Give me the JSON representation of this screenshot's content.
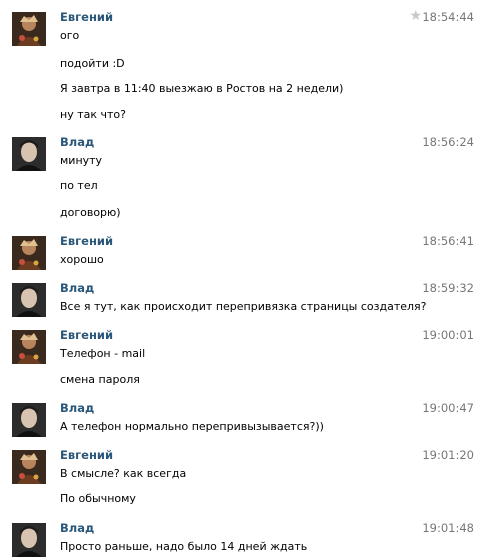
{
  "messages": [
    {
      "author": "Евгений",
      "time": "18:54:44",
      "avatar": "avatar-evgeniy",
      "starred": true,
      "lines": [
        "ого",
        "подойти :D",
        "Я завтра в 11:40 выезжаю в Ростов на 2 недели)",
        "ну так что?"
      ]
    },
    {
      "author": "Влад",
      "time": "18:56:24",
      "avatar": "avatar-vlad",
      "lines": [
        "минуту",
        "по тел",
        "договорю)"
      ]
    },
    {
      "author": "Евгений",
      "time": "18:56:41",
      "avatar": "avatar-evgeniy",
      "lines": [
        "хорошо"
      ]
    },
    {
      "author": "Влад",
      "time": "18:59:32",
      "avatar": "avatar-vlad",
      "lines": [
        "Все я тут, как происходит перепривязка страницы создателя?"
      ]
    },
    {
      "author": "Евгений",
      "time": "19:00:01",
      "avatar": "avatar-evgeniy",
      "lines": [
        "Телефон - mail",
        "смена пароля"
      ]
    },
    {
      "author": "Влад",
      "time": "19:00:47",
      "avatar": "avatar-vlad",
      "lines": [
        "А телефон нормально перепривызывается?))"
      ]
    },
    {
      "author": "Евгений",
      "time": "19:01:20",
      "avatar": "avatar-evgeniy",
      "lines": [
        "В смысле? как всегда",
        "По обычному"
      ]
    },
    {
      "author": "Влад",
      "time": "19:01:48",
      "avatar": "avatar-vlad",
      "lines": [
        "Просто раньше, надо было 14 дней ждать"
      ]
    }
  ]
}
